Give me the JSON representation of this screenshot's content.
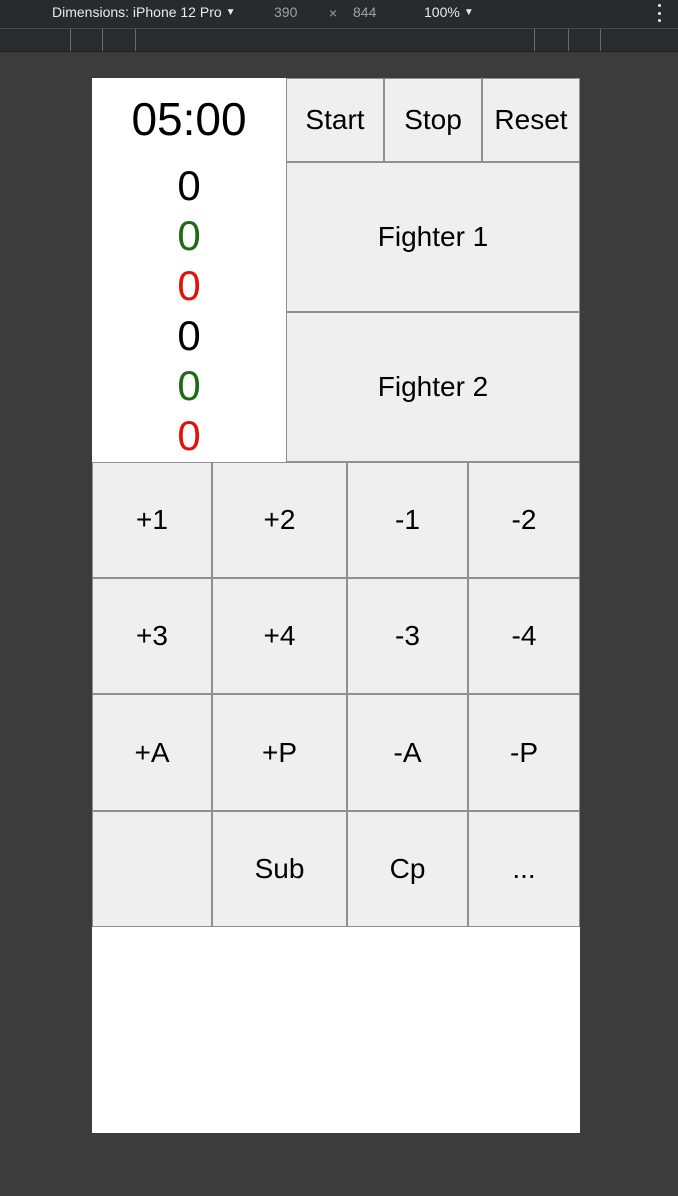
{
  "devtools": {
    "device_label": "Dimensions: iPhone 12 Pro",
    "width": "390",
    "times": "×",
    "height": "844",
    "zoom": "100%",
    "caret": "▼"
  },
  "timer": "05:00",
  "fighter1_scores": [
    "0",
    "0",
    "0"
  ],
  "fighter2_scores": [
    "0",
    "0",
    "0"
  ],
  "controls": {
    "start": "Start",
    "stop": "Stop",
    "reset": "Reset"
  },
  "fighters": {
    "fighter1": "Fighter 1",
    "fighter2": "Fighter 2"
  },
  "pad": [
    [
      "+1",
      "+2",
      "-1",
      "-2"
    ],
    [
      "+3",
      "+4",
      "-3",
      "-4"
    ],
    [
      "+A",
      "+P",
      "-A",
      "-P"
    ],
    [
      "",
      "Sub",
      "Cp",
      "..."
    ]
  ]
}
